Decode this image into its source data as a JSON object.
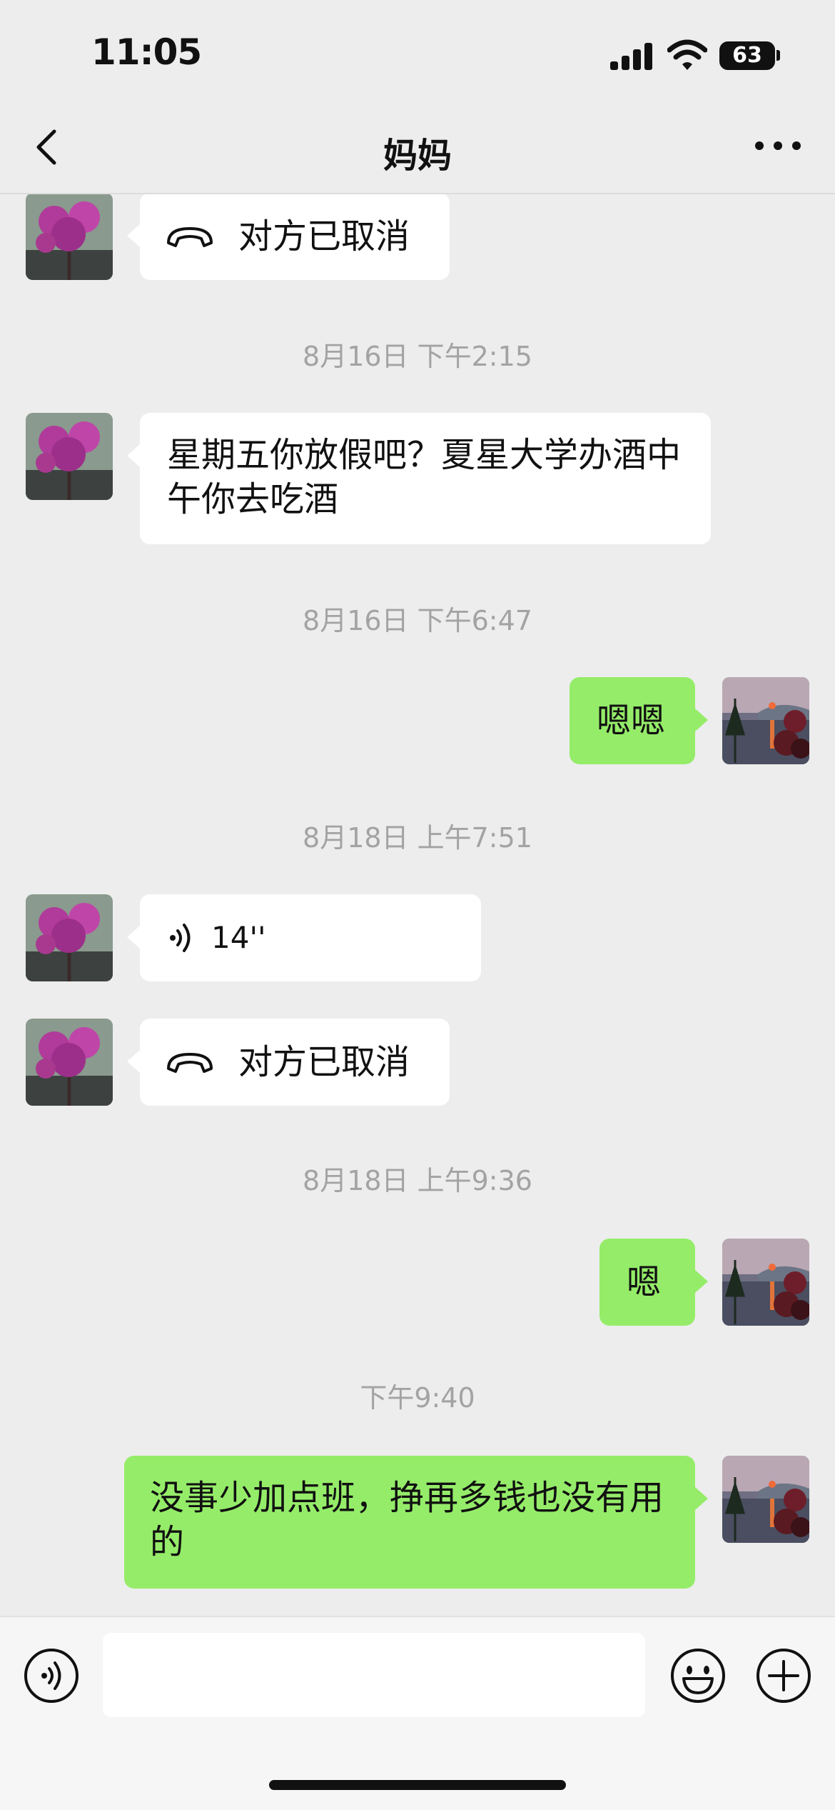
{
  "status_bar": {
    "time": "11:05",
    "battery": "63"
  },
  "nav": {
    "title": "妈妈"
  },
  "messages": {
    "m1": {
      "text": "对方已取消"
    },
    "t1": "8月16日 下午2:15",
    "m2": {
      "text": "星期五你放假吧？夏星大学办酒中午你去吃酒"
    },
    "t2": "8月16日 下午6:47",
    "m3": {
      "text": "嗯嗯"
    },
    "t3": "8月18日 上午7:51",
    "m4": {
      "text": "14''"
    },
    "m5": {
      "text": "对方已取消"
    },
    "t4": "8月18日 上午9:36",
    "m6": {
      "text": "嗯"
    },
    "t5": "下午9:40",
    "m7": {
      "text": "没事少加点班，挣再多钱也没有用的"
    }
  },
  "icons": {
    "back": "chevron-left-icon",
    "more": "more-dots-icon",
    "call": "phone-hangup-icon",
    "voice": "voice-wave-icon",
    "emoji": "emoji-icon",
    "add": "plus-circle-icon"
  },
  "colors": {
    "outgoing_bubble": "#95ec69",
    "incoming_bubble": "#ffffff",
    "background": "#ededed"
  }
}
